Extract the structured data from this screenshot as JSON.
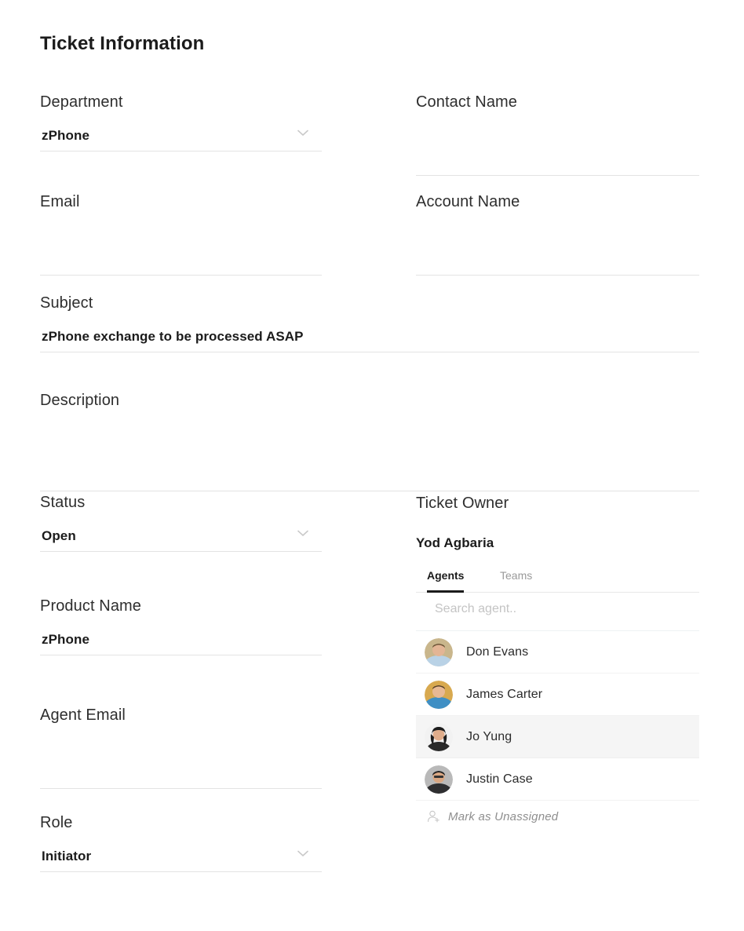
{
  "header": {
    "title": "Ticket Information"
  },
  "fields": {
    "department": {
      "label": "Department",
      "value": "zPhone",
      "placeholder": "",
      "icon": "chevron-down-icon"
    },
    "contact_name": {
      "label": "Contact Name",
      "value": "",
      "placeholder": ""
    },
    "email": {
      "label": "Email",
      "value": "",
      "placeholder": ""
    },
    "account_name": {
      "label": "Account Name",
      "value": "",
      "placeholder": ""
    },
    "subject": {
      "label": "Subject",
      "value": "zPhone exchange to be processed ASAP",
      "placeholder": ""
    },
    "description": {
      "label": "Description",
      "value": "",
      "placeholder": ""
    },
    "status": {
      "label": "Status",
      "value": "Open",
      "placeholder": "",
      "icon": "chevron-down-icon"
    },
    "product_name": {
      "label": "Product Name",
      "value": "zPhone",
      "placeholder": ""
    },
    "agent_email": {
      "label": "Agent Email",
      "value": "",
      "placeholder": ""
    },
    "role": {
      "label": "Role",
      "value": "Initiator",
      "placeholder": "",
      "icon": "chevron-down-icon"
    }
  },
  "ticket_owner": {
    "label": "Ticket Owner",
    "owner_name": "Yod Agbaria",
    "tabs": [
      {
        "label": "Agents",
        "active": true
      },
      {
        "label": "Teams",
        "active": false
      }
    ],
    "search": {
      "placeholder": "Search agent..",
      "value": ""
    },
    "agents": [
      {
        "name": "Don Evans",
        "selected": false,
        "avatar": "photo-avatar"
      },
      {
        "name": "James Carter",
        "selected": false,
        "avatar": "photo-avatar"
      },
      {
        "name": "Jo Yung",
        "selected": true,
        "avatar": "photo-avatar"
      },
      {
        "name": "Justin Case",
        "selected": false,
        "avatar": "photo-avatar"
      }
    ],
    "unassigned": {
      "label": "Mark as Unassigned",
      "icon": "person-add-icon"
    }
  },
  "colors": {
    "text": "#2b2b2b",
    "heading": "#1b1b1b",
    "muted": "#9a9a9a",
    "placeholder": "#c4c4c4",
    "underline": "#e3e3e3",
    "row_selected_bg": "#f5f5f5"
  }
}
